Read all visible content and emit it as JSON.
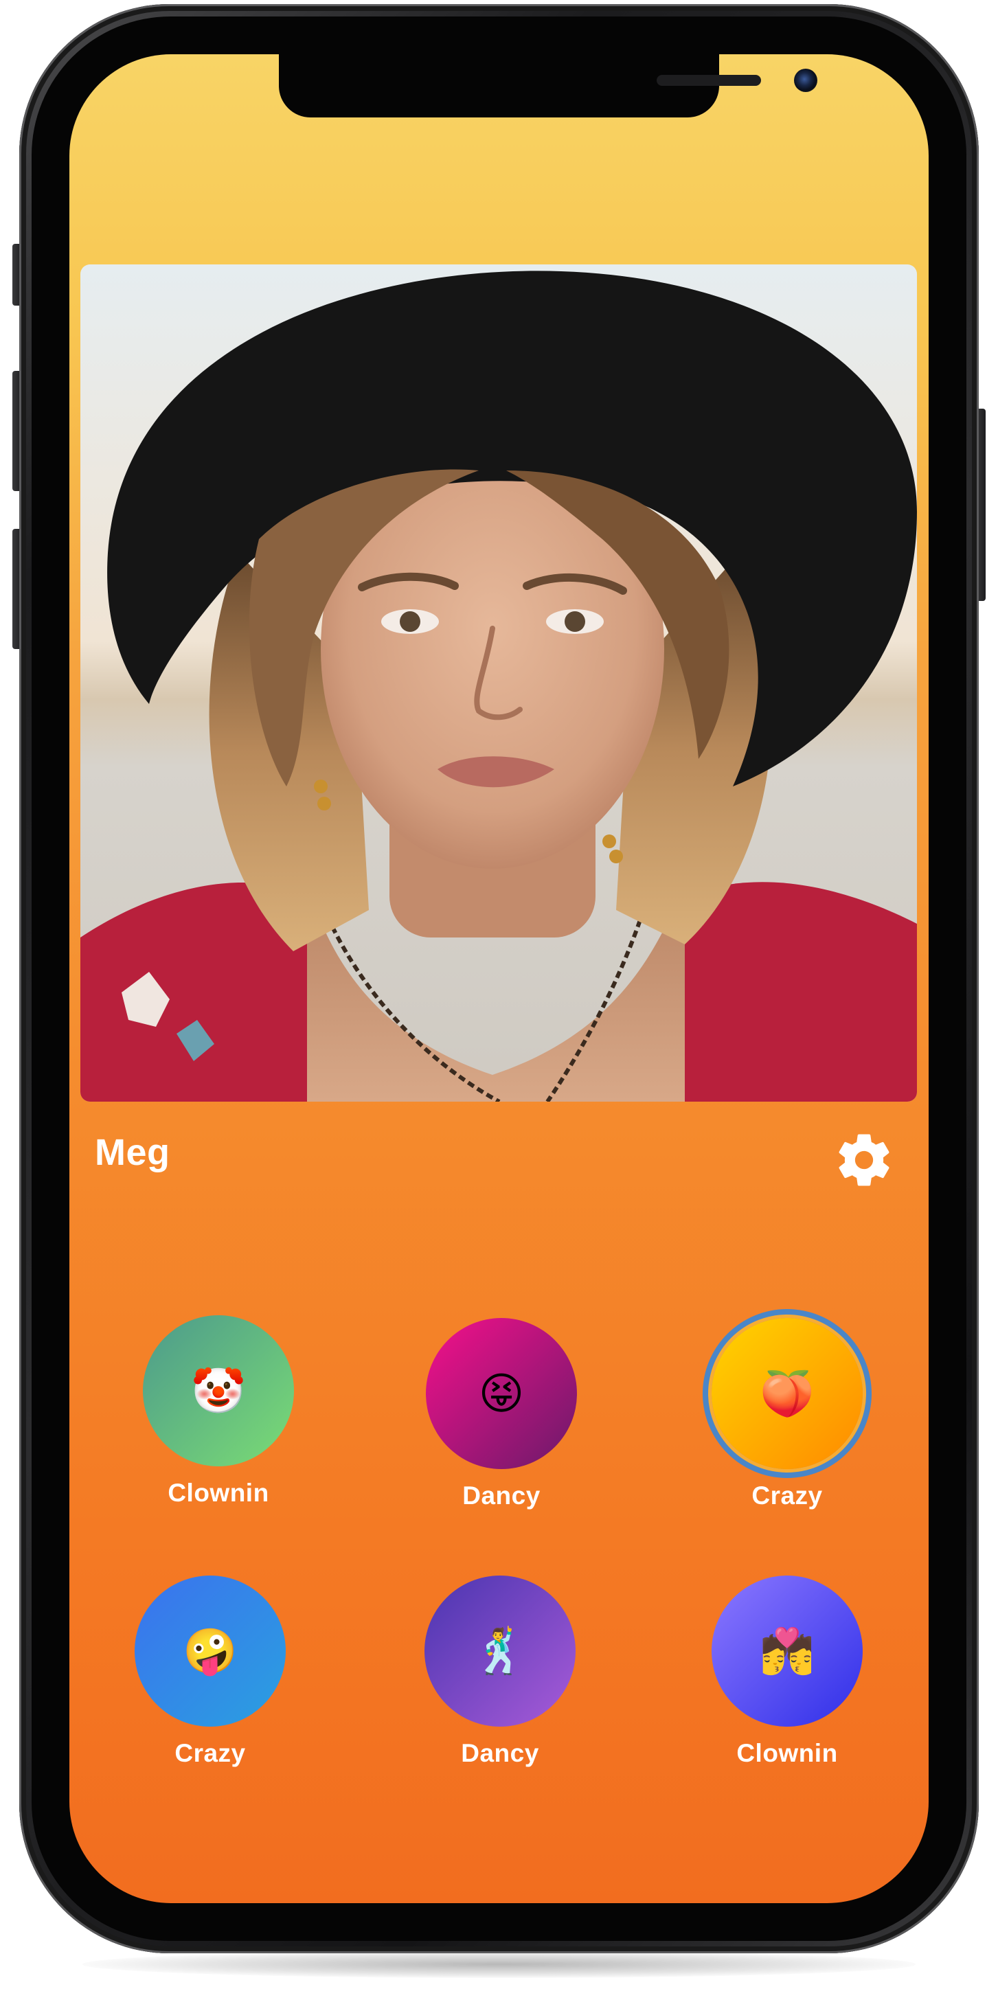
{
  "profile": {
    "name": "Meg",
    "photo_alt": "profile-photo"
  },
  "settings": {
    "icon": "gear-icon"
  },
  "moods": [
    {
      "label": "Clownin",
      "emoji": "🤡",
      "icon": "clown-icon",
      "gradient": [
        "#4c9a8c",
        "#7bdc74"
      ],
      "selected": false
    },
    {
      "label": "Dancy",
      "emoji": "😝",
      "icon": "squinting-tongue-icon",
      "gradient": [
        "#f5108a",
        "#6a1a6a"
      ],
      "selected": false
    },
    {
      "label": "Crazy",
      "emoji": "🍑",
      "icon": "peach-icon",
      "gradient": [
        "#ffd400",
        "#ff8a00"
      ],
      "selected": true
    },
    {
      "label": "Crazy",
      "emoji": "🤪",
      "icon": "zany-face-icon",
      "gradient": [
        "#3b72ee",
        "#2aa0e0"
      ],
      "selected": false
    },
    {
      "label": "Dancy",
      "emoji": "🕺",
      "icon": "man-dancing-icon",
      "gradient": [
        "#4a35b0",
        "#a85bd8"
      ],
      "selected": false
    },
    {
      "label": "Clownin",
      "emoji": "💏",
      "icon": "couple-kiss-icon",
      "gradient": [
        "#8c78ff",
        "#2f2fe8"
      ],
      "selected": false
    }
  ],
  "colors": {
    "screen_top": "#f8d466",
    "screen_bottom": "#f26d1f",
    "selected_ring": "#4a86c8",
    "text": "#ffffff"
  }
}
